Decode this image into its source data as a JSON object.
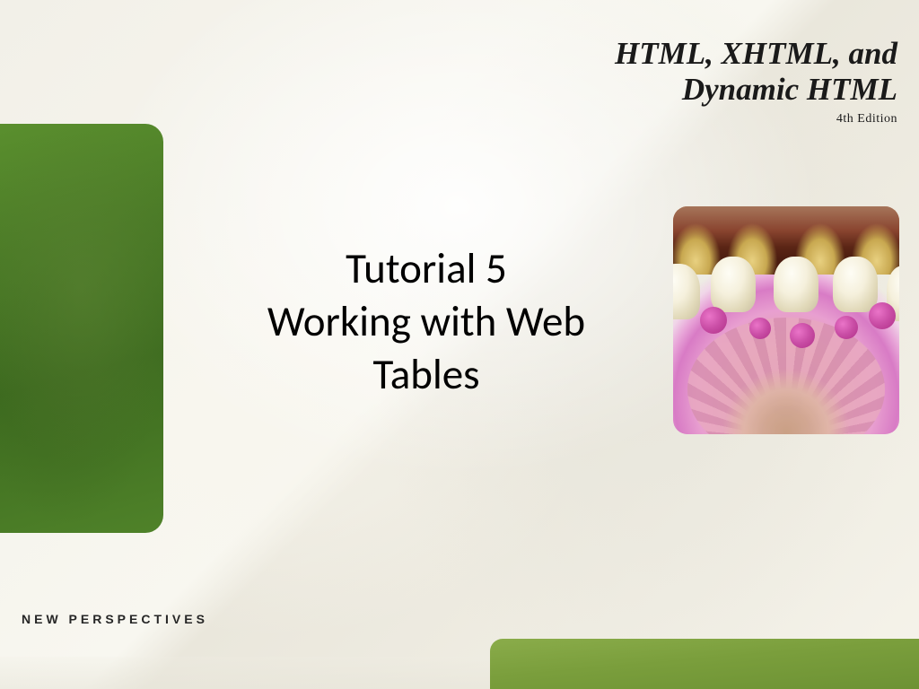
{
  "book": {
    "title_line1": "HTML, XHTML, and",
    "title_line2": "Dynamic HTML",
    "edition": "4th Edition"
  },
  "slide": {
    "title_line1": "Tutorial 5",
    "title_line2": "Working with Web",
    "title_line3": "Tables"
  },
  "brand": {
    "tagline": "NEW PERSPECTIVES"
  }
}
